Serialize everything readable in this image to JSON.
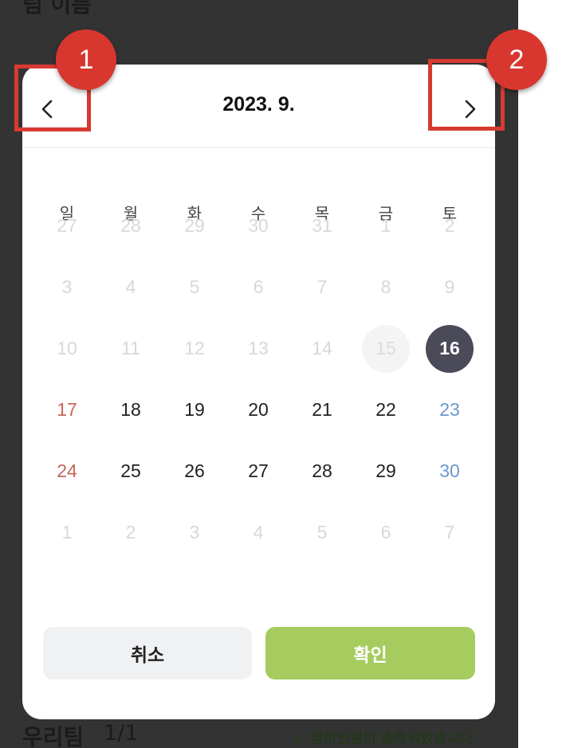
{
  "background": {
    "top_label": "팀 이름",
    "team_title": "우리팀",
    "team_count": "1/1",
    "status_text": "참여인원이 충족되었습니다."
  },
  "picker": {
    "title": "2023.  9.",
    "prev_icon": "chevron-left-icon",
    "next_icon": "chevron-right-icon",
    "weekdays": [
      "일",
      "월",
      "화",
      "수",
      "목",
      "금",
      "토"
    ],
    "weeks": [
      [
        {
          "label": "27",
          "state": "muted"
        },
        {
          "label": "28",
          "state": "muted"
        },
        {
          "label": "29",
          "state": "muted"
        },
        {
          "label": "30",
          "state": "muted"
        },
        {
          "label": "31",
          "state": "muted"
        },
        {
          "label": "1",
          "state": "muted"
        },
        {
          "label": "2",
          "state": "muted"
        }
      ],
      [
        {
          "label": "3",
          "state": "muted"
        },
        {
          "label": "4",
          "state": "muted"
        },
        {
          "label": "5",
          "state": "muted"
        },
        {
          "label": "6",
          "state": "muted"
        },
        {
          "label": "7",
          "state": "muted"
        },
        {
          "label": "8",
          "state": "muted"
        },
        {
          "label": "9",
          "state": "muted"
        }
      ],
      [
        {
          "label": "10",
          "state": "muted"
        },
        {
          "label": "11",
          "state": "muted"
        },
        {
          "label": "12",
          "state": "muted"
        },
        {
          "label": "13",
          "state": "muted"
        },
        {
          "label": "14",
          "state": "muted"
        },
        {
          "label": "15",
          "state": "today"
        },
        {
          "label": "16",
          "state": "selected"
        }
      ],
      [
        {
          "label": "17",
          "state": "sun"
        },
        {
          "label": "18",
          "state": "normal"
        },
        {
          "label": "19",
          "state": "normal"
        },
        {
          "label": "20",
          "state": "normal"
        },
        {
          "label": "21",
          "state": "normal"
        },
        {
          "label": "22",
          "state": "normal"
        },
        {
          "label": "23",
          "state": "sat"
        }
      ],
      [
        {
          "label": "24",
          "state": "sun"
        },
        {
          "label": "25",
          "state": "normal"
        },
        {
          "label": "26",
          "state": "normal"
        },
        {
          "label": "27",
          "state": "normal"
        },
        {
          "label": "28",
          "state": "normal"
        },
        {
          "label": "29",
          "state": "normal"
        },
        {
          "label": "30",
          "state": "sat"
        }
      ],
      [
        {
          "label": "1",
          "state": "muted"
        },
        {
          "label": "2",
          "state": "muted"
        },
        {
          "label": "3",
          "state": "muted"
        },
        {
          "label": "4",
          "state": "muted"
        },
        {
          "label": "5",
          "state": "muted"
        },
        {
          "label": "6",
          "state": "muted"
        },
        {
          "label": "7",
          "state": "muted"
        }
      ]
    ],
    "cancel_label": "취소",
    "confirm_label": "확인"
  },
  "annotations": {
    "badge_1": "1",
    "badge_2": "2",
    "color": "#d63a31"
  },
  "colors": {
    "overlay": "#333333",
    "confirm": "#a6cb5e",
    "selected": "#4a4a59",
    "sunday": "#c5665a",
    "saturday": "#6c95cf"
  }
}
